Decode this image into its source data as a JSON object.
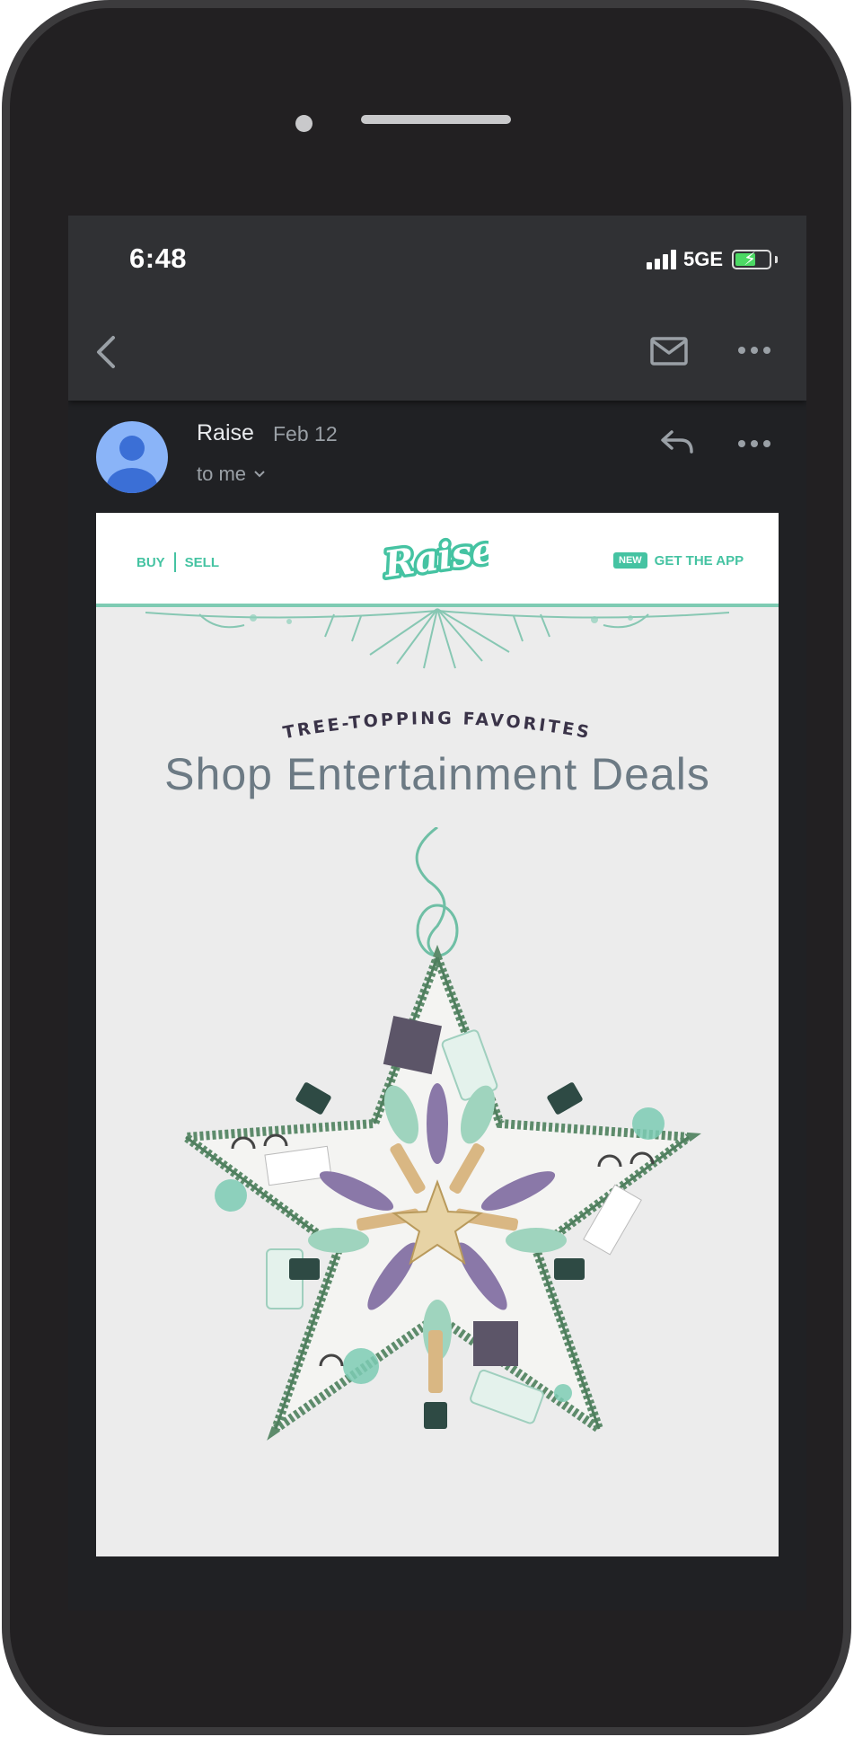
{
  "status_bar": {
    "time": "6:48",
    "network": "5GE",
    "battery_level": 0.6,
    "signal_bars": 4
  },
  "app_bar": {
    "back_icon": "chevron-left-icon",
    "mail_icon": "envelope-icon",
    "more_icon": "more-horizontal-icon"
  },
  "message": {
    "sender": "Raise",
    "date": "Feb 12",
    "recipient": "to me",
    "reply_icon": "reply-icon",
    "more_icon": "more-horizontal-icon"
  },
  "email": {
    "nav": {
      "buy": "BUY",
      "sell": "SELL",
      "new_badge": "NEW",
      "get_app": "GET THE APP"
    },
    "logo_text": "Raise",
    "eyebrow": "TREE-TOPPING FAVORITES",
    "headline": "Shop Entertainment Deals",
    "hero_image": "star-ornament-image",
    "colors": {
      "brand": "#45c3a2",
      "headline": "#6c7a84",
      "eyebrow": "#3a3348"
    }
  }
}
